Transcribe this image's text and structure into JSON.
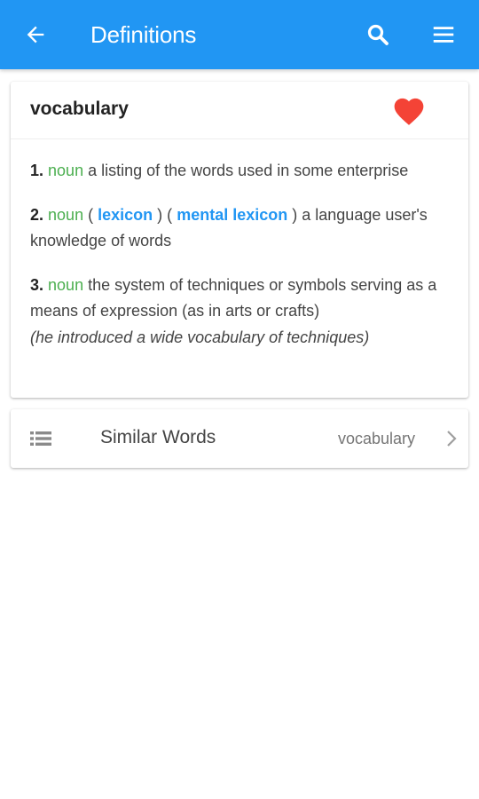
{
  "app_bar": {
    "title": "Definitions",
    "background_color": "#2196f3",
    "icons": [
      "arrow-back-icon",
      "search-icon",
      "menu-icon"
    ]
  },
  "word_card": {
    "word": "vocabulary",
    "favorite_icon": "heart-icon",
    "favorite_color": "#f44336",
    "definitions": [
      {
        "number": "1.",
        "part_of_speech": "noun",
        "text": "a listing of the words used in some enterprise"
      },
      {
        "number": "2.",
        "part_of_speech": "noun",
        "open_paren_1": "(",
        "synonym_1": "lexicon",
        "close_paren_1": ")",
        "open_paren_2": "(",
        "synonym_2": "mental lexicon",
        "close_paren_2": ")",
        "text": "a language user's knowledge of words"
      },
      {
        "number": "3.",
        "part_of_speech": "noun",
        "text": "the system of techniques or symbols serving as a means of expression (as in arts or crafts)",
        "example": "(he introduced a wide vocabulary of techniques)"
      }
    ],
    "part_of_speech_color": "#4caf50",
    "synonym_color": "#2196f3"
  },
  "similar_words": {
    "label": "Similar Words",
    "value": "vocabulary",
    "icons": [
      "list-icon",
      "chevron-right-icon"
    ]
  }
}
